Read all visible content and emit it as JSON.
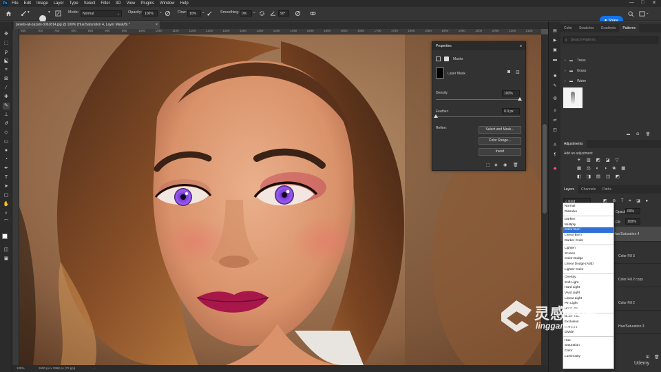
{
  "app": {
    "logo": "Ps",
    "menu": [
      "File",
      "Edit",
      "Image",
      "Layer",
      "Type",
      "Select",
      "Filter",
      "3D",
      "View",
      "Plugins",
      "Window",
      "Help"
    ]
  },
  "options": {
    "mode_label": "Mode:",
    "mode_value": "Normal",
    "opacity_label": "Opacity:",
    "opacity_value": "100%",
    "flow_label": "Flow:",
    "flow_value": "10%",
    "smoothing_label": "Smoothing:",
    "smoothing_value": "0%",
    "angle_value": "90°",
    "brush_size": "24",
    "share_label": "Share"
  },
  "document": {
    "tab_title": "pexels-ali-pazani-3061814.jpg @ 100% (Hue/Saturation 4, Layer Mask/8) *",
    "zoom": "100%",
    "dims": "2600 px x 2998 px (72 ppi)",
    "ruler_ticks": [
      "650",
      "700",
      "750",
      "800",
      "850",
      "900",
      "950",
      "1000",
      "1050",
      "1100",
      "1150",
      "1200",
      "1250",
      "1300",
      "1350",
      "1400",
      "1450",
      "1500",
      "1550",
      "1600",
      "1650",
      "1700",
      "1750",
      "1800",
      "1850",
      "1900",
      "1950",
      "2000",
      "2050",
      "2100",
      "2150"
    ]
  },
  "properties": {
    "title": "Properties",
    "masks_label": "Masks",
    "layer_mask_label": "Layer Mask",
    "density_label": "Density:",
    "density_value": "100%",
    "density_fraction": 1.0,
    "feather_label": "Feather:",
    "feather_value": "0.0 px",
    "feather_fraction": 0.0,
    "refine_label": "Refine:",
    "select_mask_btn": "Select and Mask...",
    "color_range_btn": "Color Range...",
    "invert_btn": "Invert"
  },
  "right_panel": {
    "top_tabs": [
      "Color",
      "Swatches",
      "Gradients",
      "Patterns"
    ],
    "search_placeholder": "Search Patterns",
    "groups": [
      "Trees",
      "Grass",
      "Water"
    ],
    "adjustments_title": "Adjustments",
    "add_adjustment": "Add an adjustment",
    "layer_tabs": [
      "Layers",
      "Channels",
      "Paths"
    ],
    "kind_label": "Kind",
    "opacity_label": "Opacity:",
    "opacity_value": "69%",
    "fill_label": "Fill:",
    "fill_value": "100%",
    "layer_names": [
      "Hue/Saturation 4",
      "Color Fill 3",
      "Color Fill 2 copy",
      "Color Fill 2",
      "Hue/Saturation 3"
    ]
  },
  "blend_modes": {
    "selected": "Color Burn",
    "groups": [
      [
        "Normal",
        "Dissolve"
      ],
      [
        "Darken",
        "Multiply",
        "Color Burn",
        "Linear Burn",
        "Darker Color"
      ],
      [
        "Lighten",
        "Screen",
        "Color Dodge",
        "Linear Dodge (Add)",
        "Lighter Color"
      ],
      [
        "Overlay",
        "Soft Light",
        "Hard Light",
        "Vivid Light",
        "Linear Light",
        "Pin Light",
        "Hard Mix"
      ],
      [
        "Difference",
        "Exclusion",
        "Subtract",
        "Divide"
      ],
      [
        "Hue",
        "Saturation",
        "Color",
        "Luminosity"
      ]
    ]
  },
  "watermark": {
    "chinese": "灵感中国",
    "url": "lingganchina.com",
    "corner": "Udemy"
  },
  "colors": {
    "panel_bg": "#323232",
    "accent": "#1473e6",
    "selection": "#2f6fd6"
  }
}
